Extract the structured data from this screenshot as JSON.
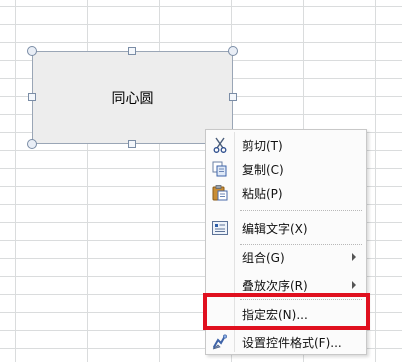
{
  "shape": {
    "text": "同心圆"
  },
  "context_menu": {
    "items": [
      {
        "label": "剪切(T)",
        "icon": "scissors-icon"
      },
      {
        "label": "复制(C)",
        "icon": "copy-icon"
      },
      {
        "label": "粘贴(P)",
        "icon": "paste-icon"
      },
      {
        "label": "编辑文字(X)",
        "icon": "edit-text-icon"
      },
      {
        "label": "组合(G)",
        "submenu": true
      },
      {
        "label": "叠放次序(R)",
        "submenu": true
      },
      {
        "label": "指定宏(N)..."
      },
      {
        "label": "设置控件格式(F)...",
        "icon": "format-control-icon"
      }
    ]
  },
  "colors": {
    "highlight": "#e0101f",
    "grid_line": "#dadcdd"
  }
}
